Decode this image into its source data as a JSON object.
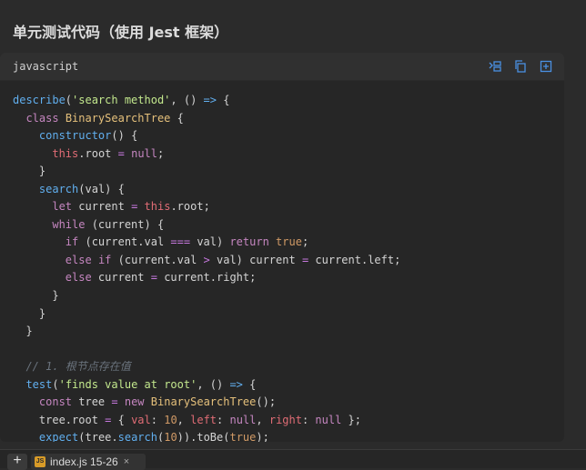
{
  "heading": "单元测试代码（使用 Jest 框架）",
  "code_block": {
    "language": "javascript",
    "toolbar": [
      {
        "icon": "insert-code-icon"
      },
      {
        "icon": "copy-icon"
      },
      {
        "icon": "add-to-file-icon"
      }
    ],
    "lines": [
      [
        [
          "fn",
          "describe"
        ],
        [
          "p",
          "("
        ],
        [
          "str",
          "'search method'"
        ],
        [
          "p",
          ", () "
        ],
        [
          "arrow",
          "=>"
        ],
        [
          "p",
          " {"
        ]
      ],
      [
        [
          "p",
          "  "
        ],
        [
          "kw",
          "class"
        ],
        [
          "p",
          " "
        ],
        [
          "cls",
          "BinarySearchTree"
        ],
        [
          "p",
          " {"
        ]
      ],
      [
        [
          "p",
          "    "
        ],
        [
          "fn",
          "constructor"
        ],
        [
          "p",
          "() {"
        ]
      ],
      [
        [
          "p",
          "      "
        ],
        [
          "this",
          "this"
        ],
        [
          "p",
          ".root "
        ],
        [
          "op",
          "="
        ],
        [
          "p",
          " "
        ],
        [
          "kw",
          "null"
        ],
        [
          "p",
          ";"
        ]
      ],
      [
        [
          "p",
          "    }"
        ]
      ],
      [
        [
          "p",
          "    "
        ],
        [
          "fn",
          "search"
        ],
        [
          "p",
          "(val) {"
        ]
      ],
      [
        [
          "p",
          "      "
        ],
        [
          "kw",
          "let"
        ],
        [
          "p",
          " current "
        ],
        [
          "op",
          "="
        ],
        [
          "p",
          " "
        ],
        [
          "this",
          "this"
        ],
        [
          "p",
          ".root;"
        ]
      ],
      [
        [
          "p",
          "      "
        ],
        [
          "kw",
          "while"
        ],
        [
          "p",
          " (current) {"
        ]
      ],
      [
        [
          "p",
          "        "
        ],
        [
          "kw",
          "if"
        ],
        [
          "p",
          " (current.val "
        ],
        [
          "op",
          "==="
        ],
        [
          "p",
          " val) "
        ],
        [
          "kw",
          "return"
        ],
        [
          "p",
          " "
        ],
        [
          "bool",
          "true"
        ],
        [
          "p",
          ";"
        ]
      ],
      [
        [
          "p",
          "        "
        ],
        [
          "kw",
          "else"
        ],
        [
          "p",
          " "
        ],
        [
          "kw",
          "if"
        ],
        [
          "p",
          " (current.val "
        ],
        [
          "op",
          ">"
        ],
        [
          "p",
          " val) current "
        ],
        [
          "op",
          "="
        ],
        [
          "p",
          " current.left;"
        ]
      ],
      [
        [
          "p",
          "        "
        ],
        [
          "kw",
          "else"
        ],
        [
          "p",
          " current "
        ],
        [
          "op",
          "="
        ],
        [
          "p",
          " current.right;"
        ]
      ],
      [
        [
          "p",
          "      }"
        ]
      ],
      [
        [
          "p",
          "    }"
        ]
      ],
      [
        [
          "p",
          "  }"
        ]
      ],
      [
        [
          "p",
          ""
        ]
      ],
      [
        [
          "p",
          "  "
        ],
        [
          "cm",
          "// 1. 根节点存在值"
        ]
      ],
      [
        [
          "p",
          "  "
        ],
        [
          "fn",
          "test"
        ],
        [
          "p",
          "("
        ],
        [
          "str",
          "'finds value at root'"
        ],
        [
          "p",
          ", () "
        ],
        [
          "arrow",
          "=>"
        ],
        [
          "p",
          " {"
        ]
      ],
      [
        [
          "p",
          "    "
        ],
        [
          "kw",
          "const"
        ],
        [
          "p",
          " tree "
        ],
        [
          "op",
          "="
        ],
        [
          "p",
          " "
        ],
        [
          "kw",
          "new"
        ],
        [
          "p",
          " "
        ],
        [
          "cls",
          "BinarySearchTree"
        ],
        [
          "p",
          "();"
        ]
      ],
      [
        [
          "p",
          "    tree.root "
        ],
        [
          "op",
          "="
        ],
        [
          "p",
          " { "
        ],
        [
          "prop",
          "val"
        ],
        [
          "p",
          ": "
        ],
        [
          "num",
          "10"
        ],
        [
          "p",
          ", "
        ],
        [
          "prop",
          "left"
        ],
        [
          "p",
          ": "
        ],
        [
          "kw",
          "null"
        ],
        [
          "p",
          ", "
        ],
        [
          "prop",
          "right"
        ],
        [
          "p",
          ": "
        ],
        [
          "kw",
          "null"
        ],
        [
          "p",
          " };"
        ]
      ],
      [
        [
          "p",
          "    "
        ],
        [
          "fn",
          "expect"
        ],
        [
          "p",
          "(tree."
        ],
        [
          "fn",
          "search"
        ],
        [
          "p",
          "("
        ],
        [
          "num",
          "10"
        ],
        [
          "p",
          ")).toBe("
        ],
        [
          "bool",
          "true"
        ],
        [
          "p",
          ");"
        ]
      ]
    ]
  },
  "bottom_bar": {
    "add_label": "+",
    "tab_label": "index.js 15-26",
    "tab_close": "×",
    "tab_icon_label": "JS"
  }
}
